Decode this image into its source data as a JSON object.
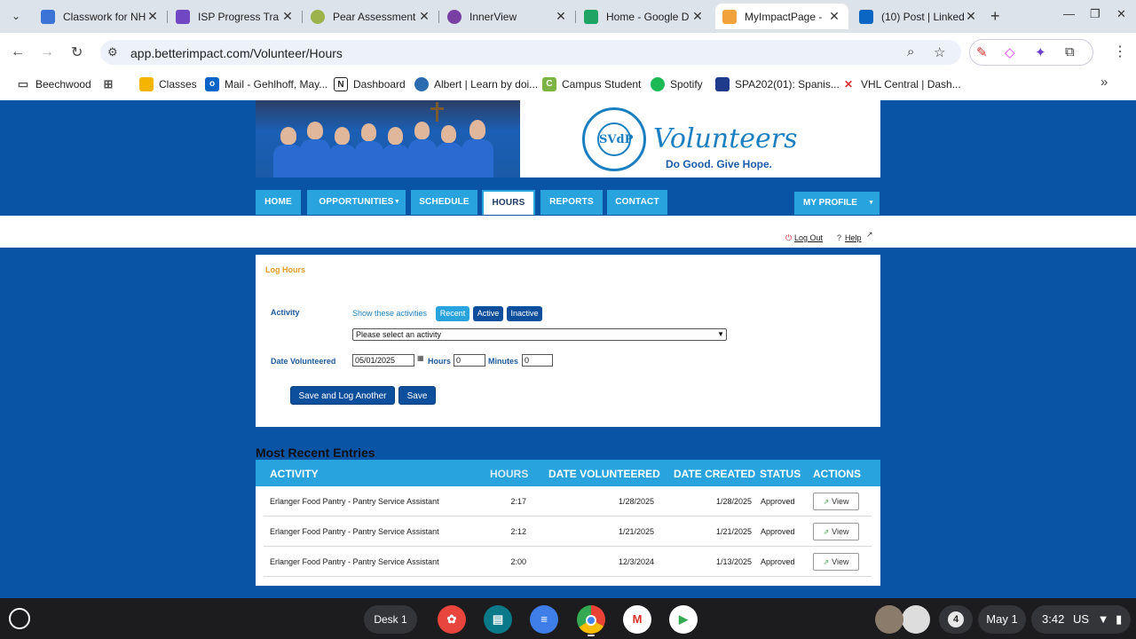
{
  "browser": {
    "tabs": [
      {
        "title": "Classwork for NH",
        "favicon_color": "#3b73d6"
      },
      {
        "title": "ISP Progress Tra",
        "favicon_color": "#7247c4"
      },
      {
        "title": "Pear Assessment",
        "favicon_color": "#9bb34a"
      },
      {
        "title": "InnerView",
        "favicon_color": "#7a3fa3"
      },
      {
        "title": "Home - Google D",
        "favicon_color": "#1fa463"
      },
      {
        "title": "MyImpactPage - ",
        "favicon_color": "#f2a23a"
      },
      {
        "title": "(10) Post | Linked",
        "favicon_color": "#0a66c2"
      }
    ],
    "active_tab_index": 5,
    "url": "app.betterimpact.com/Volunteer/Hours",
    "bookmarks": [
      {
        "label": "Beechwood",
        "icon": "folder-icon",
        "color": "#555555"
      },
      {
        "label": "",
        "icon": "apps-grid-icon",
        "color": "#555555"
      },
      {
        "label": "Classes",
        "icon": "classroom-icon",
        "color": "#f5b400"
      },
      {
        "label": "Mail - Gehlhoff, May...",
        "icon": "outlook-icon",
        "color": "#0a64c8"
      },
      {
        "label": "Dashboard",
        "icon": "notion-icon",
        "color": "#222222"
      },
      {
        "label": "Albert | Learn by doi...",
        "icon": "albert-icon",
        "color": "#2b6cb0"
      },
      {
        "label": "Campus Student",
        "icon": "campus-icon",
        "color": "#7cb342"
      },
      {
        "label": "Spotify",
        "icon": "spotify-icon",
        "color": "#1db954"
      },
      {
        "label": "SPA202(01): Spanis...",
        "icon": "school-crest-icon",
        "color": "#1e3a8a"
      },
      {
        "label": "VHL Central | Dash...",
        "icon": "vhl-icon",
        "color": "#d32f2f"
      }
    ]
  },
  "site": {
    "slogan": "Do Good. Give Hope.",
    "logo_word": "Volunteers",
    "seal_text": "SVdP",
    "nav": [
      {
        "label": "HOME",
        "dropdown": false
      },
      {
        "label": "OPPORTUNITIES",
        "dropdown": true
      },
      {
        "label": "SCHEDULE",
        "dropdown": false
      },
      {
        "label": "HOURS",
        "dropdown": false
      },
      {
        "label": "REPORTS",
        "dropdown": false
      },
      {
        "label": "CONTACT",
        "dropdown": false
      }
    ],
    "active_nav": "HOURS",
    "profile_label": "MY PROFILE",
    "logout_label": "Log Out",
    "help_label": "Help"
  },
  "log_hours": {
    "title": "Log Hours",
    "activity_label": "Activity",
    "show_label": "Show these activities",
    "filters": [
      "Recent",
      "Active",
      "Inactive"
    ],
    "selected_filter": "Recent",
    "activity_placeholder": "Please select an activity",
    "date_label": "Date Volunteered",
    "date_value": "05/01/2025",
    "hours_label": "Hours",
    "hours_value": "0",
    "minutes_label": "Minutes",
    "minutes_value": "0",
    "save_another_label": "Save and Log Another",
    "save_label": "Save"
  },
  "recent": {
    "title": "Most Recent Entries",
    "columns": [
      "ACTIVITY",
      "HOURS",
      "DATE VOLUNTEERED",
      "DATE CREATED",
      "STATUS",
      "ACTIONS"
    ],
    "rows": [
      {
        "activity": "Erlanger Food Pantry - Pantry Service Assistant",
        "hours": "2:17",
        "date_volunteered": "1/28/2025",
        "date_created": "1/28/2025",
        "status": "Approved",
        "action": "View"
      },
      {
        "activity": "Erlanger Food Pantry - Pantry Service Assistant",
        "hours": "2:12",
        "date_volunteered": "1/21/2025",
        "date_created": "1/21/2025",
        "status": "Approved",
        "action": "View"
      },
      {
        "activity": "Erlanger Food Pantry - Pantry Service Assistant",
        "hours": "2:00",
        "date_volunteered": "12/3/2024",
        "date_created": "1/13/2025",
        "status": "Approved",
        "action": "View"
      }
    ]
  },
  "shelf": {
    "desk_label": "Desk 1",
    "notification_count": "4",
    "date": "May 1",
    "time": "3:42",
    "locale": "US"
  },
  "colors": {
    "page_bg": "#0954a4",
    "nav_tab": "#29a3dd",
    "accent_orange": "#e89b22",
    "button_dark": "#0d4f9c"
  }
}
